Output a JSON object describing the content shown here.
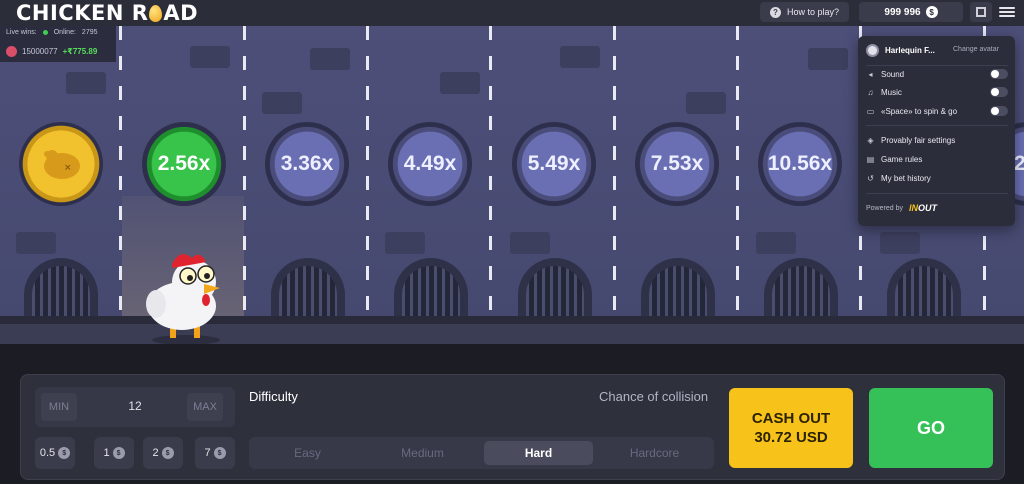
{
  "header": {
    "logo_left": "CHICKEN R",
    "logo_right": "AD",
    "how_to_play": "How to play?",
    "balance": "999 996",
    "currency_icon": "dollar-coin-icon"
  },
  "live": {
    "wins_label": "Live wins:",
    "online_label": "Online:",
    "online_count": "2795",
    "last_win_user": "15000077",
    "last_win_amount": "+₹775.89"
  },
  "multipliers": [
    "2.56x",
    "3.36x",
    "4.49x",
    "5.49x",
    "7.53x",
    "10.56x",
    "2"
  ],
  "menu": {
    "user_name": "Harlequin F...",
    "change_avatar": "Change avatar",
    "sound": "Sound",
    "music": "Music",
    "space_spin": "«Space» to spin & go",
    "provably_fair": "Provably fair settings",
    "game_rules": "Game rules",
    "bet_history": "My bet history",
    "powered_by": "Powered by",
    "brand_in": "IN",
    "brand_out": "OUT"
  },
  "bet": {
    "min_label": "MIN",
    "max_label": "MAX",
    "amount": "12",
    "quick": [
      "0.5",
      "1",
      "2",
      "7"
    ]
  },
  "difficulty": {
    "label": "Difficulty",
    "chance_label": "Chance of collision",
    "options": [
      "Easy",
      "Medium",
      "Hard",
      "Hardcore"
    ],
    "selected": "Hard"
  },
  "cashout": {
    "line1": "CASH OUT",
    "line2": "30.72 USD"
  },
  "go_label": "GO",
  "colors": {
    "accent_yellow": "#f7c21a",
    "accent_green": "#35c158",
    "panel": "#2e303c"
  }
}
